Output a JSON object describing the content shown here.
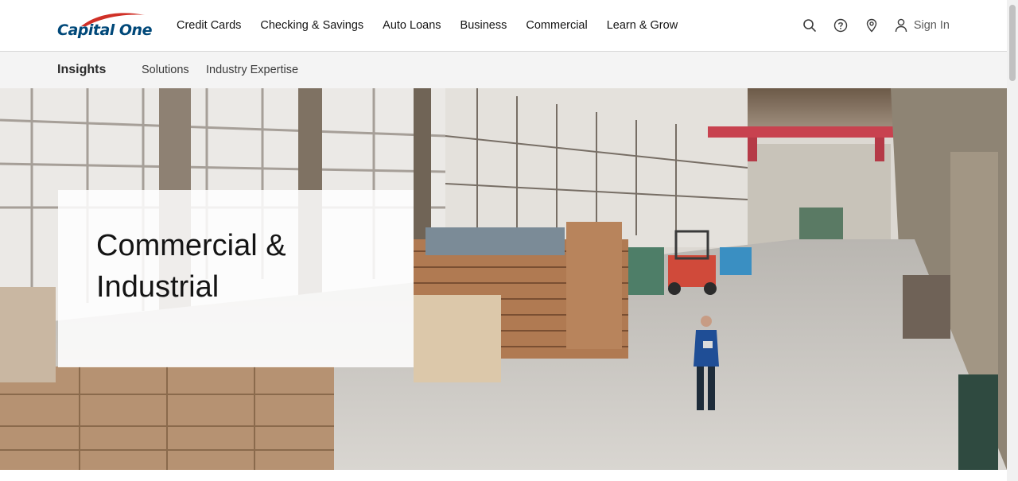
{
  "brand": {
    "logo_text": "Capital One",
    "logo_color": "#004879",
    "swoosh_color": "#d03027"
  },
  "nav": {
    "items": [
      "Credit Cards",
      "Checking & Savings",
      "Auto Loans",
      "Business",
      "Commercial",
      "Learn & Grow"
    ],
    "icons": [
      "search-icon",
      "help-icon",
      "location-pin-icon",
      "user-icon"
    ],
    "sign_in": "Sign In"
  },
  "subnav": {
    "brand": "Insights",
    "links": [
      "Solutions",
      "Industry Expertise"
    ]
  },
  "hero": {
    "title": "Commercial & Industrial",
    "image": "warehouse-photo"
  }
}
